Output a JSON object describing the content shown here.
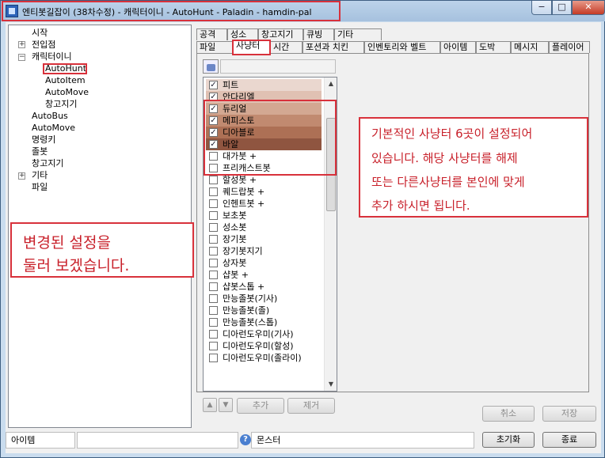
{
  "window": {
    "title": "엔티봇길잡이 (38차수정) - 캐릭터이니 - AutoHunt - Paladin - hamdin-pal",
    "minimize": "−",
    "maximize": "□",
    "close": "✕"
  },
  "tree": {
    "items": [
      {
        "label": "시작"
      },
      {
        "label": "전입점",
        "expander": "+"
      },
      {
        "label": "캐릭터이니",
        "expander": "−"
      },
      {
        "label": "AutoHunt"
      },
      {
        "label": "AutoItem"
      },
      {
        "label": "AutoMove"
      },
      {
        "label": "창고지기"
      },
      {
        "label": "AutoBus"
      },
      {
        "label": "AutoMove"
      },
      {
        "label": "명령키"
      },
      {
        "label": "졸봇"
      },
      {
        "label": "창고지기"
      },
      {
        "label": "기타",
        "expander": "+"
      },
      {
        "label": "파일"
      }
    ]
  },
  "left_note": {
    "line1": "변경된 설정을",
    "line2": "둘러 보겠습니다."
  },
  "tabs": {
    "row1": [
      "공격",
      "성소",
      "창고지기",
      "큐빙",
      "기타"
    ],
    "row2": [
      "파일",
      "사냥터",
      "시간",
      "포션과 치킨",
      "인벤토리와 벨트",
      "아이템",
      "도박",
      "메시지",
      "플레이어"
    ],
    "active": "사냥터"
  },
  "hunt_list": {
    "items": [
      {
        "label": "피트",
        "checked": true,
        "color": "#ead7cf"
      },
      {
        "label": "안다리엘",
        "checked": true,
        "color": "#e0c1b3"
      },
      {
        "label": "듀리얼",
        "checked": true,
        "color": "#d3a892"
      },
      {
        "label": "메피스토",
        "checked": true,
        "color": "#c18a70"
      },
      {
        "label": "디아블로",
        "checked": true,
        "color": "#ad7055"
      },
      {
        "label": "바알",
        "checked": true,
        "color": "#8f5540"
      },
      {
        "label": "대가붓 +",
        "checked": false
      },
      {
        "label": "프리캐스트봇",
        "checked": false
      },
      {
        "label": "할성봇 +",
        "checked": false
      },
      {
        "label": "퀘드랍봇 +",
        "checked": false
      },
      {
        "label": "인헨트봇 +",
        "checked": false
      },
      {
        "label": "보초봇",
        "checked": false
      },
      {
        "label": "성소봇",
        "checked": false
      },
      {
        "label": "장기봇",
        "checked": false
      },
      {
        "label": "장기봇지기",
        "checked": false
      },
      {
        "label": "상자봇",
        "checked": false
      },
      {
        "label": "샵봇 +",
        "checked": false
      },
      {
        "label": "샵봇스톱 +",
        "checked": false
      },
      {
        "label": "만능졸봇(기사)",
        "checked": false
      },
      {
        "label": "만능졸봇(졸)",
        "checked": false
      },
      {
        "label": "만능졸봇(스톱)",
        "checked": false
      },
      {
        "label": "디아런도우미(기사)",
        "checked": false
      },
      {
        "label": "디아런도우미(할성)",
        "checked": false
      },
      {
        "label": "디아런도우미(졸라이)",
        "checked": false
      }
    ],
    "check_mark": "✓",
    "scroll_up": "▲",
    "scroll_down": "▼"
  },
  "list_buttons": {
    "up": "▲",
    "down": "▼",
    "add": "추가",
    "remove": "제거"
  },
  "note": {
    "line1": "기본적인 사냥터 6곳이 설정되어",
    "line2": "있습니다. 해당 사냥터를 해제",
    "line3": "또는 다른사냥터를 본인에 맞게",
    "line4": "추가 하시면 됩니다."
  },
  "actions": {
    "cancel": "취소",
    "save": "저장",
    "reset": "초기화",
    "exit": "종료"
  },
  "status": {
    "left": "아이템",
    "help": "?",
    "right": "몬스터"
  }
}
